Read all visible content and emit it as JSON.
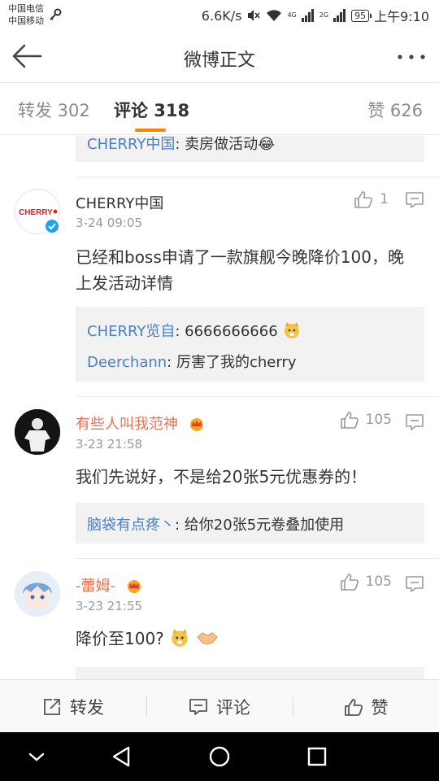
{
  "status_bar": {
    "carrier_1": "中国电信",
    "carrier_2": "中国移动",
    "speed": "6.6K/s",
    "net_1": "4G",
    "net_2": "2G",
    "battery": "95",
    "time": "上午9:10"
  },
  "header": {
    "title": "微博正文"
  },
  "tabs": {
    "repost": "转发 302",
    "comment": "评论 318",
    "like": "赞 626"
  },
  "comments": [
    {
      "reply_preview": {
        "name": "CHERRY中国",
        "text": ": 卖房做活动😂"
      }
    },
    {
      "name": "CHERRY中国",
      "time": "3-24 09:05",
      "likes": "1",
      "avatar_text": "CHERRY",
      "content": "已经和boss申请了一款旗舰今晚降价100，晚上发活动详情",
      "replies": [
        {
          "name": "CHERRY览自",
          "text": ": 6666666666"
        },
        {
          "name": "Deerchann",
          "text": ": 厉害了我的cherry"
        }
      ]
    },
    {
      "name": "有些人叫我范神",
      "time": "3-23 21:58",
      "likes": "105",
      "content": "我们先说好，不是给20张5元优惠券的！",
      "replies": [
        {
          "name": "脑袋有点疼丶",
          "text": ": 给你20张5元卷叠加使用"
        }
      ]
    },
    {
      "name": "-蕾姆-",
      "time": "3-23 21:55",
      "likes": "105",
      "content": "降价至100?"
    }
  ],
  "action_bar": {
    "repost": "转发",
    "comment": "评论",
    "like": "赞"
  },
  "colors": {
    "accent": "#ff8200",
    "link": "#4a7fc1",
    "vip_name": "#eb7350",
    "verified": "#1da1f2"
  }
}
